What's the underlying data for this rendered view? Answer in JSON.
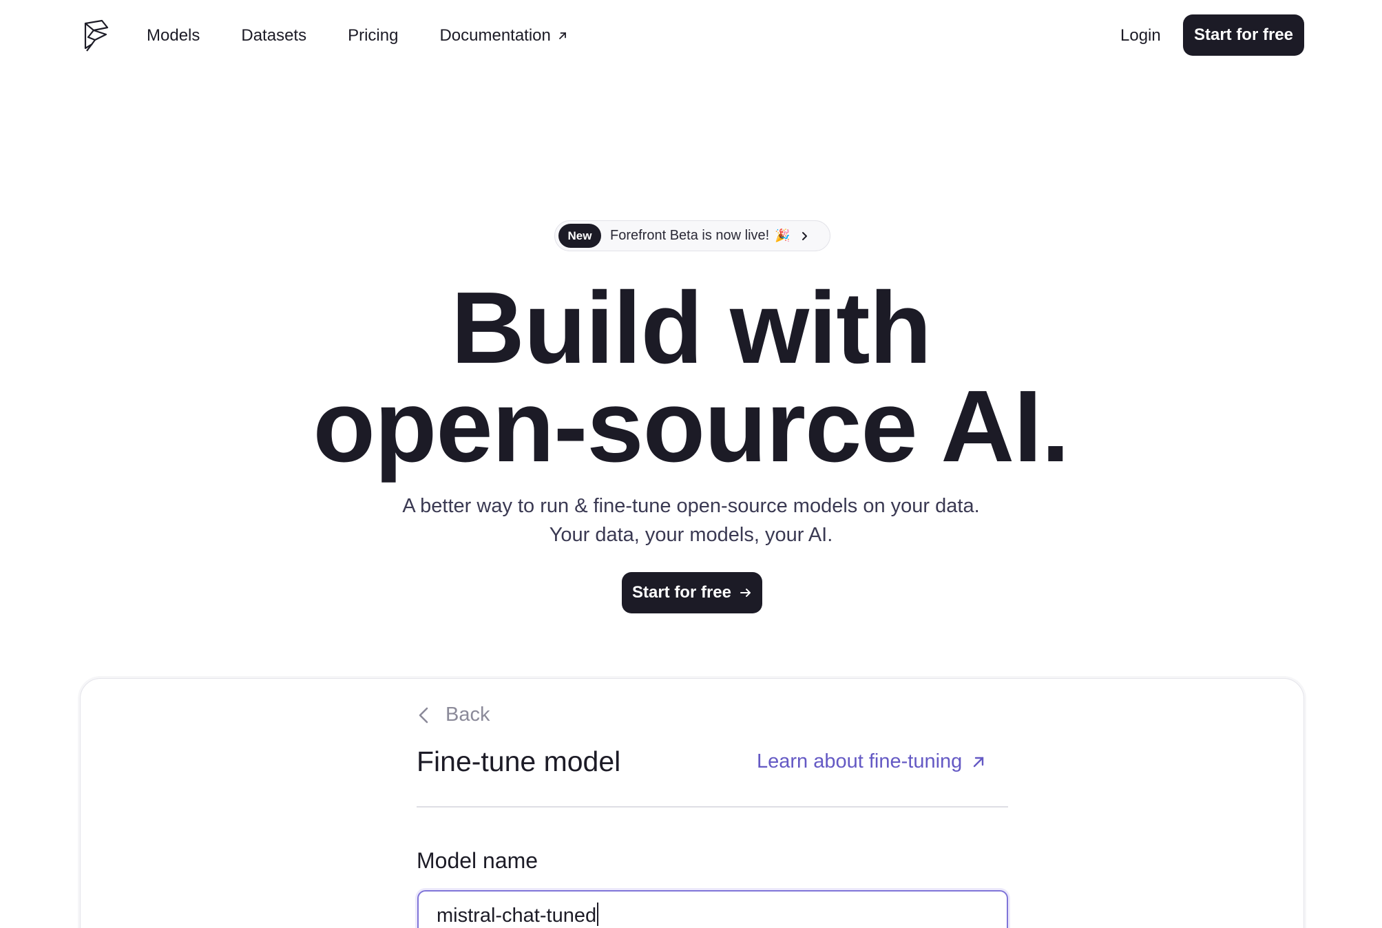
{
  "nav": {
    "links": [
      {
        "label": "Models"
      },
      {
        "label": "Datasets"
      },
      {
        "label": "Pricing"
      },
      {
        "label": "Documentation"
      }
    ],
    "login": "Login",
    "cta": "Start for free"
  },
  "hero": {
    "badge_tag": "New",
    "badge_text": "Forefront Beta is now live!",
    "badge_emoji": "🎉",
    "title_line1": "Build with",
    "title_line2": "open-source AI.",
    "subtitle_line1": "A better way to run & fine-tune open-source models on your data.",
    "subtitle_line2": "Your data, your models, your AI.",
    "cta": "Start for free"
  },
  "preview": {
    "back_label": "Back",
    "title": "Fine-tune model",
    "learn_link": "Learn about fine-tuning",
    "field_label": "Model name",
    "field_value": "mistral-chat-tuned"
  },
  "colors": {
    "dark": "#1c1b26",
    "link": "#6459c4",
    "input_border": "#7f74d8"
  },
  "icons": {
    "logo": "forefront-logo-icon",
    "external": "arrow-up-right-icon",
    "chevron": "chevron-right-icon",
    "back": "chevron-left-icon",
    "arrow": "arrow-right-icon"
  }
}
